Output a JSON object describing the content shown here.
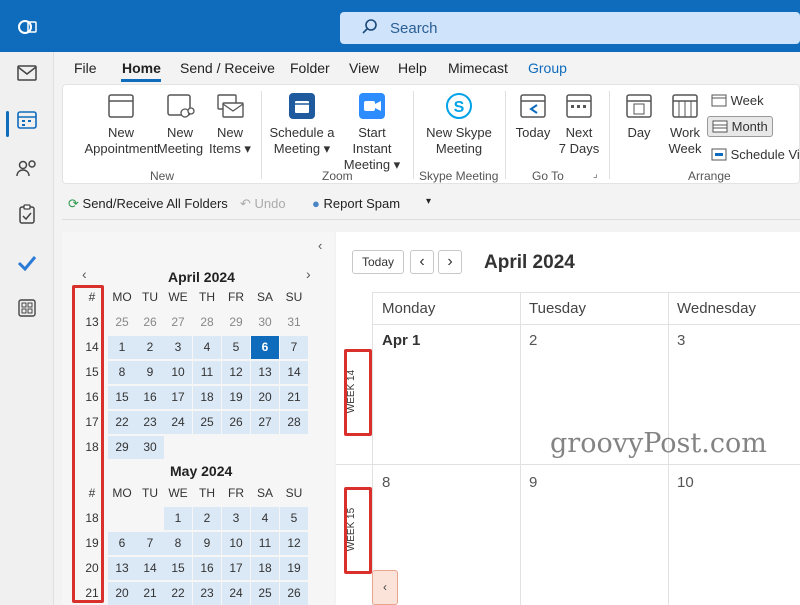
{
  "search": {
    "placeholder": "Search"
  },
  "menu": {
    "items": [
      "File",
      "Home",
      "Send / Receive",
      "Folder",
      "View",
      "Help",
      "Mimecast",
      "Group"
    ]
  },
  "ribbon": {
    "new_appointment": [
      "New",
      "Appointment"
    ],
    "new_meeting": [
      "New",
      "Meeting"
    ],
    "new_items": [
      "New",
      "Items ▾"
    ],
    "schedule_meeting": [
      "Schedule a",
      "Meeting ▾"
    ],
    "start_instant_meeting": [
      "Start Instant",
      "Meeting ▾"
    ],
    "new_skype_meeting": [
      "New Skype",
      "Meeting"
    ],
    "today": [
      "Today",
      ""
    ],
    "next7": [
      "Next",
      "7 Days"
    ],
    "day": [
      "Day",
      ""
    ],
    "work_week": [
      "Work",
      "Week"
    ],
    "week": "Week",
    "month": "Month",
    "schedule_view": "Schedule Vie",
    "groups": {
      "new": "New",
      "zoom": "Zoom",
      "skype": "Skype Meeting",
      "goto": "Go To",
      "arrange": "Arrange"
    }
  },
  "qat": {
    "send_receive": "Send/Receive All Folders",
    "undo": "Undo",
    "report_spam": "Report Spam"
  },
  "mini_cal": {
    "april_title": "April 2024",
    "may_title": "May 2024",
    "weekday_headers": [
      "#",
      "MO",
      "TU",
      "WE",
      "TH",
      "FR",
      "SA",
      "SU"
    ],
    "april_rows": [
      [
        "13",
        "25",
        "26",
        "27",
        "28",
        "29",
        "30",
        "31"
      ],
      [
        "14",
        "1",
        "2",
        "3",
        "4",
        "5",
        "6",
        "7"
      ],
      [
        "15",
        "8",
        "9",
        "10",
        "11",
        "12",
        "13",
        "14"
      ],
      [
        "16",
        "15",
        "16",
        "17",
        "18",
        "19",
        "20",
        "21"
      ],
      [
        "17",
        "22",
        "23",
        "24",
        "25",
        "26",
        "27",
        "28"
      ],
      [
        "18",
        "29",
        "30",
        "",
        "",
        "",
        "",
        ""
      ]
    ],
    "may_rows": [
      [
        "18",
        "",
        "",
        "1",
        "2",
        "3",
        "4",
        "5"
      ],
      [
        "19",
        "6",
        "7",
        "8",
        "9",
        "10",
        "11",
        "12"
      ],
      [
        "20",
        "13",
        "14",
        "15",
        "16",
        "17",
        "18",
        "19"
      ],
      [
        "21",
        "20",
        "21",
        "22",
        "23",
        "24",
        "25",
        "26"
      ]
    ],
    "today": "6"
  },
  "calendar": {
    "today_button": "Today",
    "prev": "‹",
    "next": "›",
    "title": "April 2024",
    "day_headers": [
      "Monday",
      "Tuesday",
      "Wednesday"
    ],
    "week_labels": [
      "WEEK 14",
      "WEEK 15"
    ],
    "row1_dates": [
      "Apr 1",
      "2",
      "3"
    ],
    "row2_dates": [
      "8",
      "9",
      "10"
    ],
    "collapse": "‹"
  },
  "watermark": "groovyPost.com",
  "colors": {
    "brand": "#0f6cbd",
    "highlight_box": "#d9302c"
  }
}
